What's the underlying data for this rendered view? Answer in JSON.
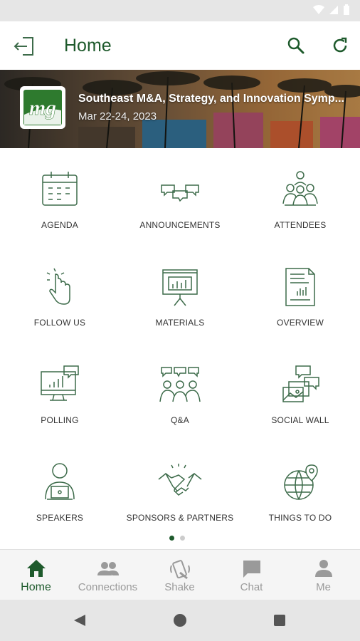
{
  "header": {
    "title": "Home"
  },
  "event": {
    "name": "Southeast M&A, Strategy, and Innovation Symp...",
    "dates": "Mar 22-24, 2023",
    "logo_text": "mg"
  },
  "tiles": [
    {
      "label": "AGENDA",
      "icon": "calendar-icon"
    },
    {
      "label": "ANNOUNCEMENTS",
      "icon": "speech-bubbles-icon"
    },
    {
      "label": "ATTENDEES",
      "icon": "people-group-icon"
    },
    {
      "label": "FOLLOW US",
      "icon": "tap-hand-icon"
    },
    {
      "label": "MATERIALS",
      "icon": "presentation-board-icon"
    },
    {
      "label": "OVERVIEW",
      "icon": "document-chart-icon"
    },
    {
      "label": "POLLING",
      "icon": "monitor-chart-icon"
    },
    {
      "label": "Q&A",
      "icon": "qa-people-icon"
    },
    {
      "label": "SOCIAL WALL",
      "icon": "social-photos-icon"
    },
    {
      "label": "SPEAKERS",
      "icon": "speaker-laptop-icon"
    },
    {
      "label": "SPONSORS & PARTNERS",
      "icon": "handshake-icon"
    },
    {
      "label": "THINGS TO DO",
      "icon": "globe-pin-icon"
    }
  ],
  "pager": {
    "pages": 2,
    "current": 1
  },
  "bottom_nav": [
    {
      "label": "Home",
      "icon": "home-icon",
      "active": true
    },
    {
      "label": "Connections",
      "icon": "people-icon",
      "active": false
    },
    {
      "label": "Shake",
      "icon": "shake-phone-icon",
      "active": false
    },
    {
      "label": "Chat",
      "icon": "chat-icon",
      "active": false
    },
    {
      "label": "Me",
      "icon": "person-icon",
      "active": false
    }
  ],
  "colors": {
    "brand": "#1e5a2c",
    "inactive": "#9a9a9a",
    "icon_stroke": "#3d6b4a"
  }
}
